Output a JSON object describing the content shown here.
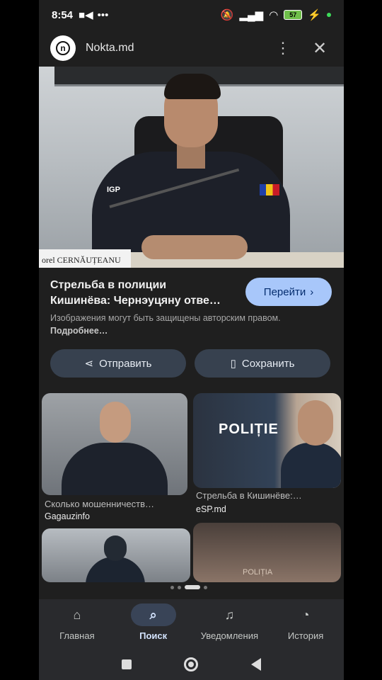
{
  "status_bar": {
    "time": "8:54",
    "battery": "57"
  },
  "header": {
    "site_name": "Nokta.md",
    "logo_letter": "n"
  },
  "main_image": {
    "nameplate": "orel CERNĂUȚEANU",
    "patch_text": "IGP"
  },
  "result": {
    "title_line1": "Стрельба в полиции",
    "title_line2": "Кишинёва: Чернэуцяну отве…",
    "visit_label": "Перейти",
    "copyright_text": "Изображения могут быть защищены авторским правом.",
    "more_link": "Подробнее…",
    "share_label": "Отправить",
    "save_label": "Сохранить"
  },
  "related": [
    {
      "caption": "Сколько мошенничеств…",
      "source": "Gagauzinfo"
    },
    {
      "caption": "Стрельба в Кишинёве:…",
      "source": "eSP.md",
      "image_text": "POLIȚIE"
    },
    {
      "caption": "",
      "source": ""
    },
    {
      "caption": "",
      "source": "",
      "image_text": "POLIȚIA"
    }
  ],
  "bottom_nav": {
    "items": [
      {
        "label": "Главная",
        "icon": "home-icon"
      },
      {
        "label": "Поиск",
        "icon": "search-icon"
      },
      {
        "label": "Уведомления",
        "icon": "bell-icon"
      },
      {
        "label": "История",
        "icon": "history-icon"
      }
    ],
    "active_index": 1
  },
  "colors": {
    "background": "#1f1f1f",
    "accent_button": "#a8c7fa",
    "secondary_button": "#37414f"
  }
}
